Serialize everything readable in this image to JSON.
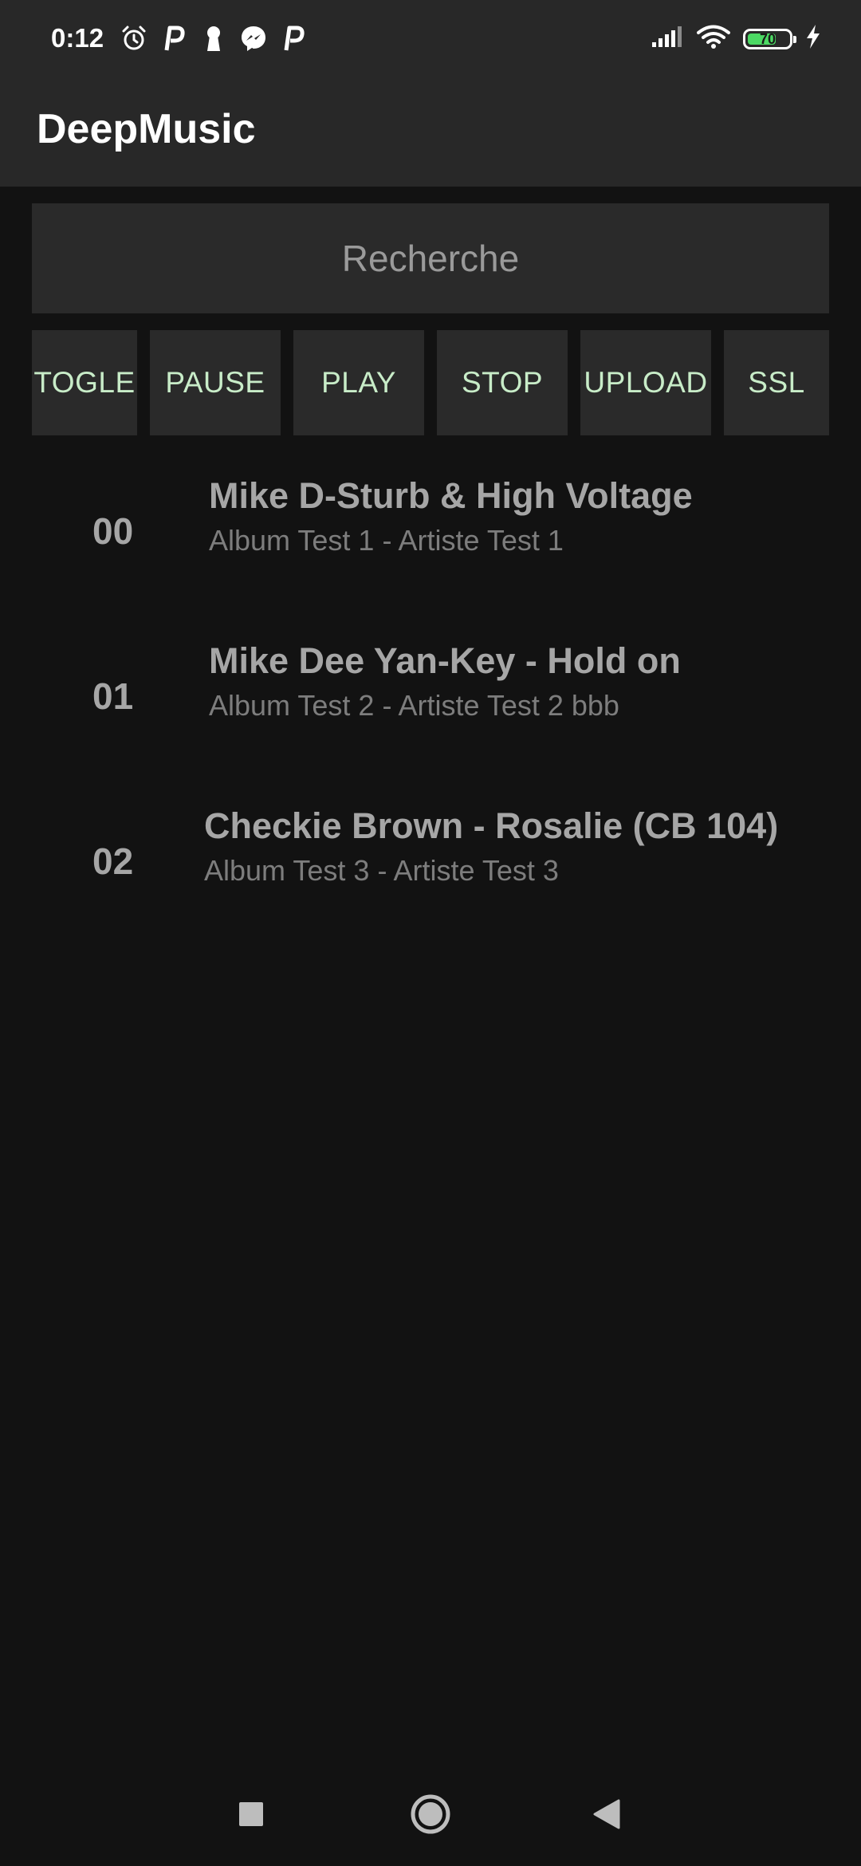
{
  "status_bar": {
    "time": "0:12",
    "battery_percent": "70",
    "battery_level": 0.7,
    "left_icons": [
      "alarm-icon",
      "parking-p-icon",
      "keyhole-icon",
      "messenger-icon",
      "parking-p-icon"
    ],
    "right_icons": [
      "signal-icon",
      "wifi-icon",
      "battery-icon",
      "charging-bolt-icon"
    ]
  },
  "app_bar": {
    "title": "DeepMusic"
  },
  "search": {
    "placeholder": "Recherche",
    "value": ""
  },
  "controls": {
    "buttons": [
      "TOGLE",
      "PAUSE",
      "PLAY",
      "STOP",
      "UPLOAD",
      "SSL"
    ]
  },
  "tracks": [
    {
      "number": "00",
      "title": "Mike D-Sturb & High Voltage",
      "subtitle": "Album Test 1 - Artiste Test 1"
    },
    {
      "number": "01",
      "title": "Mike Dee Yan-Key - Hold on",
      "subtitle": "Album Test 2 - Artiste Test 2 bbb"
    },
    {
      "number": "02",
      "title": "Checkie Brown - Rosalie (CB 104)",
      "subtitle": "Album Test 3 - Artiste Test 3"
    }
  ],
  "nav_bar": {
    "icons": [
      "recents-square-icon",
      "home-circle-icon",
      "back-triangle-icon"
    ]
  },
  "colors": {
    "background": "#121212",
    "app_bar": "#282828",
    "button_bg": "#2a2a2a",
    "button_text": "#c8ecc8",
    "track_title": "#a6a6a6",
    "track_subtitle": "#7d7d7d",
    "battery_fill": "#4cd964"
  }
}
